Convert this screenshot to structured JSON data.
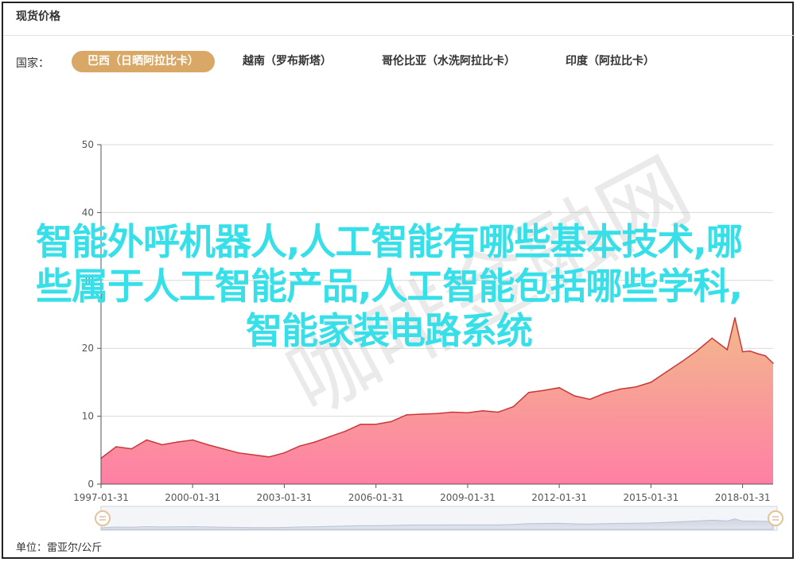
{
  "header": {
    "title": "现货价格"
  },
  "filter": {
    "label": "国家：",
    "tabs": [
      {
        "label": "巴西（日晒阿拉比卡）",
        "active": true
      },
      {
        "label": "越南（罗布斯塔）",
        "active": false
      },
      {
        "label": "哥伦比亚（水洗阿拉比卡）",
        "active": false
      },
      {
        "label": "印度（阿拉比卡）",
        "active": false
      }
    ]
  },
  "unit_label": "单位：雷亚尔/公斤",
  "overlay_text": "智能外呼机器人,人工智能有哪些基本技术,哪些属于人工智能产品,人工智能包括哪些学科,智能家装电路系统",
  "watermark_text": "咖啡金融网",
  "colors": {
    "accent": "#d9a866",
    "line": "#c8393a",
    "area_top": "#f2b98b",
    "area_bottom": "#ff7fa5",
    "overlay": "#37e0e8"
  },
  "chart_data": {
    "type": "area",
    "title": "",
    "xlabel": "",
    "ylabel": "",
    "ylim": [
      0,
      50
    ],
    "yticks": [
      0,
      10,
      20,
      30,
      40,
      50
    ],
    "xlim": [
      "1997-01-31",
      "2019-01-31"
    ],
    "xticks": [
      "1997-01-31",
      "2000-01-31",
      "2003-01-31",
      "2006-01-31",
      "2009-01-31",
      "2012-01-31",
      "2015-01-31",
      "2018-01-31"
    ],
    "grid": true,
    "series": [
      {
        "x": [
          "1997-01-31",
          "1997-07-31",
          "1998-01-31",
          "1998-07-31",
          "1999-01-31",
          "1999-07-31",
          "2000-01-31",
          "2000-07-31",
          "2001-01-31",
          "2001-07-31",
          "2002-01-31",
          "2002-07-31",
          "2003-01-31",
          "2003-07-31",
          "2004-01-31",
          "2004-07-31",
          "2005-01-31",
          "2005-07-31",
          "2006-01-31",
          "2006-07-31",
          "2007-01-31",
          "2007-07-31",
          "2008-01-31",
          "2008-07-31",
          "2009-01-31",
          "2009-07-31",
          "2010-01-31",
          "2010-07-31",
          "2011-01-31",
          "2011-07-31",
          "2012-01-31",
          "2012-07-31",
          "2013-01-31",
          "2013-07-31",
          "2014-01-31",
          "2014-07-31",
          "2015-01-31",
          "2015-07-31",
          "2016-01-31",
          "2016-07-31",
          "2017-01-31",
          "2017-07-31",
          "2017-10-31",
          "2018-01-31",
          "2018-04-30",
          "2018-07-31",
          "2018-10-31",
          "2019-01-31"
        ],
        "values": [
          3.8,
          5.5,
          5.2,
          6.5,
          5.8,
          6.2,
          6.5,
          5.8,
          5.2,
          4.6,
          4.3,
          4.0,
          4.6,
          5.6,
          6.2,
          7.0,
          7.8,
          8.8,
          8.8,
          9.2,
          10.2,
          10.3,
          10.4,
          10.6,
          10.5,
          10.8,
          10.6,
          11.4,
          13.5,
          13.8,
          14.2,
          13.0,
          12.5,
          13.4,
          14.0,
          14.3,
          15.0,
          16.5,
          18.0,
          19.6,
          21.5,
          19.8,
          24.5,
          19.5,
          19.6,
          19.2,
          18.9,
          17.8
        ]
      }
    ]
  }
}
